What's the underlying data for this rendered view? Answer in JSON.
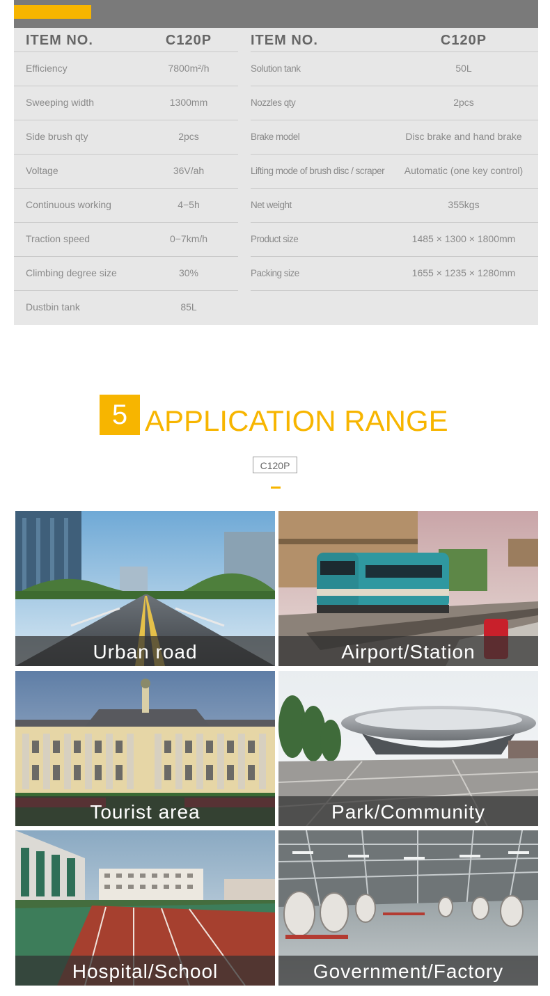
{
  "colors": {
    "accent": "#f7b500",
    "header_gray": "#7a7a7a",
    "table_bg": "#e7e7e7"
  },
  "spec_table": {
    "headers": [
      "ITEM NO.",
      "C120P",
      "ITEM NO.",
      "C120P"
    ],
    "rows": [
      [
        "Efficiency",
        "7800m²/h",
        "Solution tank",
        "50L"
      ],
      [
        "Sweeping width",
        "1300mm",
        "Nozzles qty",
        "2pcs"
      ],
      [
        "Side brush qty",
        "2pcs",
        "Brake model",
        "Disc brake and hand brake"
      ],
      [
        "Voltage",
        "36V/ah",
        "Lifting mode of brush disc / scraper",
        "Automatic (one key control)"
      ],
      [
        "Continuous working",
        "4−5h",
        "Net weight",
        "355kgs"
      ],
      [
        "Traction speed",
        "0−7km/h",
        "Product size",
        "1485 × 1300 × 1800mm"
      ],
      [
        "Climbing degree size",
        "30%",
        "Packing size",
        "1655 × 1235 × 1280mm"
      ],
      [
        "Dustbin tank",
        "85L",
        "",
        ""
      ]
    ]
  },
  "section": {
    "number": "5",
    "title": "APPLICATION RANGE",
    "model": "C120P"
  },
  "applications": [
    {
      "label": "Urban road",
      "icon": "urban-road-photo"
    },
    {
      "label": "Airport/Station",
      "icon": "train-station-photo"
    },
    {
      "label": "Tourist area",
      "icon": "palace-photo"
    },
    {
      "label": "Park/Community",
      "icon": "modern-building-photo"
    },
    {
      "label": "Hospital/School",
      "icon": "running-track-photo"
    },
    {
      "label": "Government/Factory",
      "icon": "factory-photo"
    }
  ]
}
